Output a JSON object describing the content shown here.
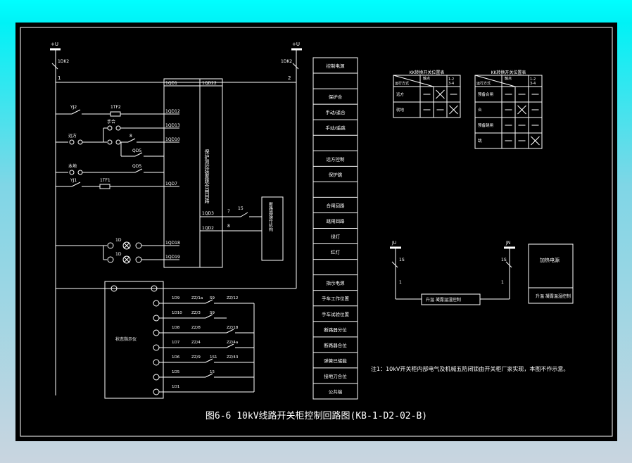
{
  "diagram": {
    "caption": "图6-6 10kV线路开关柜控制回路图(KB-1-D2-02-B)",
    "bus_left_label": "+U",
    "bus_right_label": "+U",
    "fuse_left_label": "1DK2",
    "fuse_right_label": "1DK2",
    "wire_left_num": "1",
    "wire_right_num": "2",
    "relay_box_label": "保护测控装置跳合闸回路",
    "relay_left_terminals": [
      "1QD1",
      "1QD12",
      "1QD13",
      "1QD10",
      "1QD7",
      "1QD18",
      "1QD19"
    ],
    "relay_right_terminals": [
      "1QD22",
      "1QD3",
      "1QD2"
    ],
    "left_contact_labels": [
      "YJ2",
      "1TF2",
      "远方",
      "手合",
      "8",
      "QD5",
      "QD5",
      "本地",
      "YJ1",
      "1TF1",
      "1D",
      "1D"
    ],
    "trip_link_labels": [
      "7",
      "15",
      "8"
    ],
    "mech_box_label": "断路器操作机构",
    "indicator_box_label": "状态指示仪",
    "terminal_rows": [
      {
        "num": "1D9",
        "cab": "ZZ/1a",
        "sw": "S9",
        "out": "ZZ/12"
      },
      {
        "num": "1D10",
        "cab": "ZZ/3",
        "sw": "S9",
        "out": ""
      },
      {
        "num": "1D8",
        "cab": "ZZ/8",
        "sw": "",
        "out": "ZZ/18"
      },
      {
        "num": "1D7",
        "cab": "ZZ/4",
        "sw": "",
        "out": "ZZ/4a"
      },
      {
        "num": "1D6",
        "cab": "ZZ/9",
        "sw": "1S1",
        "out": "ZZ/43"
      },
      {
        "num": "1D5",
        "cab": "",
        "sw": "15",
        "out": ""
      },
      {
        "num": "1D1",
        "cab": "",
        "sw": "",
        "out": ""
      }
    ],
    "function_column": [
      "控制电源",
      "",
      "保护合",
      "手动/遥合",
      "手动/遥跳",
      "",
      "远方控制",
      "保护跳",
      "",
      "合闸回路",
      "跳闸回路",
      "绿灯",
      "红灯",
      "",
      "指示电源",
      "手车工作位置",
      "手车试验位置",
      "断路器分位",
      "断路器合位",
      "弹簧已储能",
      "接地刀合位",
      "公共端"
    ],
    "switch_table_1": {
      "title": "KK转换开关位置表",
      "corner_top": "触点",
      "corner_bottom": "运行方式",
      "col_headers": [
        "1-2",
        "3-4"
      ],
      "rows": [
        {
          "label": "远方",
          "marks": [
            "-",
            "X",
            "-"
          ]
        },
        {
          "label": "就地",
          "marks": [
            "-",
            "-",
            "X"
          ]
        }
      ]
    },
    "switch_table_2": {
      "title": "KK转换开关位置表",
      "corner_top": "触点",
      "corner_bottom": "运行方式",
      "col_headers": [
        "1-2",
        "3-4"
      ],
      "rows": [
        {
          "label": "预备合闸",
          "marks": [
            "-",
            "-",
            "-"
          ]
        },
        {
          "label": "合",
          "marks": [
            "-",
            "X",
            "-"
          ]
        },
        {
          "label": "预备跳闸",
          "marks": [
            "-",
            "-",
            "-"
          ]
        },
        {
          "label": "跳",
          "marks": [
            "-",
            "-",
            "X"
          ]
        }
      ]
    },
    "heater_circuit": {
      "bus_left_label": "JU",
      "bus_right_label": "JN",
      "sw_left": "1S",
      "sw_right": "1S",
      "node_left": "1",
      "node_right": "1",
      "box_label": "升温 凝露温湿控制",
      "side_box_top": "加热电源",
      "side_box_bottom": "升温 凝露温湿控制"
    },
    "note": "注1：10kV开关柜内部电气及机械五防闭锁由开关柜厂家实现，本图不作示意。"
  }
}
